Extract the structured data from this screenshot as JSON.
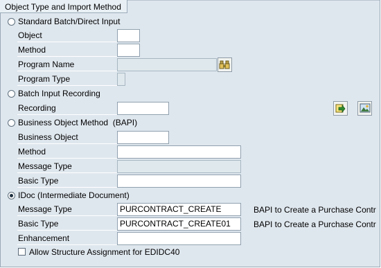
{
  "group_title": "Object Type and Import Method",
  "sections": {
    "standard": {
      "label": "Standard Batch/Direct Input",
      "object_label": "Object",
      "method_label": "Method",
      "program_name_label": "Program Name",
      "program_type_label": "Program Type"
    },
    "recording": {
      "label": "Batch Input Recording",
      "recording_label": "Recording"
    },
    "bapi": {
      "label": "Business Object Method  (BAPI)",
      "business_object_label": "Business Object",
      "method_label": "Method",
      "message_type_label": "Message Type",
      "basic_type_label": "Basic Type"
    },
    "idoc": {
      "label": "IDoc (Intermediate Document)",
      "message_type_label": "Message Type",
      "message_type_value": "PURCONTRACT_CREATE",
      "message_type_desc": "BAPI to Create a Purchase Contr",
      "basic_type_label": "Basic Type",
      "basic_type_value": "PURCONTRACT_CREATE01",
      "basic_type_desc": "BAPI to Create a Purchase Contr",
      "enhancement_label": "Enhancement"
    }
  },
  "allow_structure_label": "Allow Structure Assignment for EDIDC40",
  "selected_method": "idoc",
  "icons": [
    "program-search-icon",
    "execute-arrow-icon",
    "display-picture-icon"
  ],
  "colors": {
    "panel_bg": "#dfe7ee",
    "border": "#9aaab8",
    "readonly_bg": "#dfe8ec"
  }
}
